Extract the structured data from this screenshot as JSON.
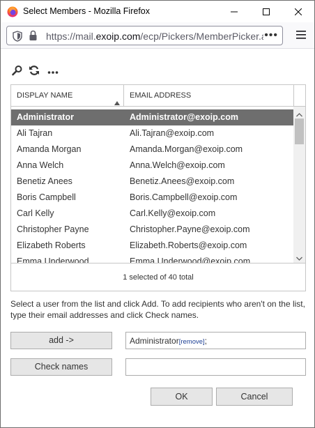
{
  "window": {
    "title": "Select Members - Mozilla Firefox"
  },
  "browser": {
    "url_prefix": "https://mail.",
    "url_domain": "exoip.com",
    "url_path": "/ecp/Pickers/MemberPicker.a",
    "more": "•••"
  },
  "grid": {
    "columns": {
      "name": "DISPLAY NAME",
      "email": "EMAIL ADDRESS"
    },
    "rows": [
      {
        "name": "Administrator",
        "email": "Administrator@exoip.com"
      },
      {
        "name": "Ali Tajran",
        "email": "Ali.Tajran@exoip.com"
      },
      {
        "name": "Amanda Morgan",
        "email": "Amanda.Morgan@exoip.com"
      },
      {
        "name": "Anna Welch",
        "email": "Anna.Welch@exoip.com"
      },
      {
        "name": "Benetiz Anees",
        "email": "Benetiz.Anees@exoip.com"
      },
      {
        "name": "Boris Campbell",
        "email": "Boris.Campbell@exoip.com"
      },
      {
        "name": "Carl Kelly",
        "email": "Carl.Kelly@exoip.com"
      },
      {
        "name": "Christopher Payne",
        "email": "Christopher.Payne@exoip.com"
      },
      {
        "name": "Elizabeth Roberts",
        "email": "Elizabeth.Roberts@exoip.com"
      },
      {
        "name": "Emma Underwood",
        "email": "Emma.Underwood@exoip.com"
      }
    ],
    "footer": "1 selected of 40 total"
  },
  "instructions": "Select a user from the list and click Add. To add recipients who aren't on the list, type their email addresses and click Check names.",
  "buttons": {
    "add": "add ->",
    "check_names": "Check names",
    "ok": "OK",
    "cancel": "Cancel"
  },
  "selected": {
    "name": "Administrator",
    "remove": "[remove]",
    "separator": ";"
  },
  "check_input": {
    "value": ""
  },
  "colors": {
    "selected_row": "#6e6e6e",
    "button_bg": "#e6e6e6",
    "link": "#1c3f94"
  }
}
